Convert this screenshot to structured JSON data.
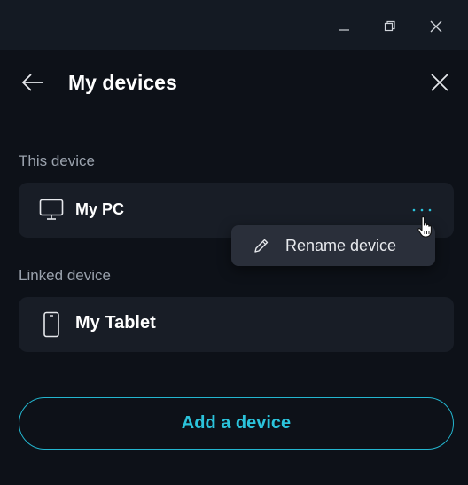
{
  "window": {
    "minimize_icon": "minimize-icon",
    "maximize_icon": "restore-icon",
    "close_icon": "close-icon"
  },
  "header": {
    "title": "My devices",
    "back_icon": "arrow-left-icon",
    "close_icon": "close-icon"
  },
  "sections": {
    "this_device": {
      "label": "This device",
      "device": {
        "name": "My PC",
        "icon": "monitor-icon",
        "more_icon": "more-dots-icon"
      }
    },
    "linked_device": {
      "label": "Linked device",
      "device": {
        "name": "My Tablet",
        "icon": "tablet-icon"
      }
    }
  },
  "context_menu": {
    "items": [
      {
        "label": "Rename device",
        "icon": "pencil-icon"
      }
    ]
  },
  "actions": {
    "add_device_label": "Add a device"
  },
  "colors": {
    "accent": "#2bc3db",
    "background": "#0d1118",
    "card": "#181d26",
    "menu": "#2a2f3a"
  }
}
